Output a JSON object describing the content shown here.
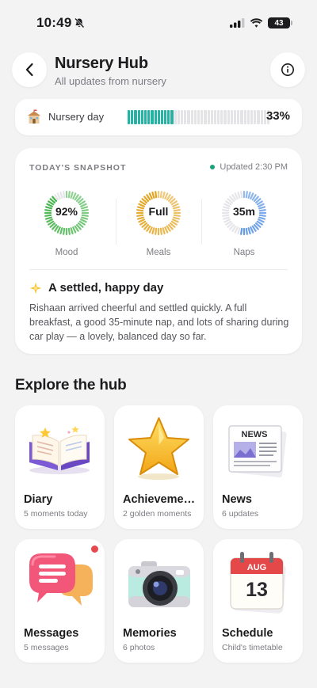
{
  "status_bar": {
    "time": "10:49",
    "battery": "43"
  },
  "header": {
    "title": "Nursery Hub",
    "subtitle": "All updates from nursery"
  },
  "progress": {
    "label": "Nursery day",
    "percent_text": "33%",
    "fraction": 0.33
  },
  "snapshot": {
    "title": "TODAY'S SNAPSHOT",
    "updated": "Updated 2:30 PM",
    "metrics": [
      {
        "value": "92%",
        "label": "Mood",
        "fill": 0.92,
        "color": "#3cb043"
      },
      {
        "value": "Full",
        "label": "Meals",
        "fill": 1.0,
        "color": "#e3a21a"
      },
      {
        "value": "35m",
        "label": "Naps",
        "fill": 0.55,
        "color": "#3b7fe0"
      }
    ],
    "headline": "A settled, happy day",
    "body": "Rishaan arrived cheerful and settled quickly. A full breakfast, a good 35-minute nap, and lots of sharing during car play — a lovely, balanced day so far."
  },
  "explore": {
    "title": "Explore the hub",
    "tiles": [
      {
        "name": "Diary",
        "sub": "5 moments today",
        "icon": "open-book-icon"
      },
      {
        "name": "Achievements",
        "sub": "2 golden moments",
        "icon": "gold-star-icon"
      },
      {
        "name": "News",
        "sub": "6 updates",
        "icon": "newspaper-icon",
        "art_text": "NEWS"
      },
      {
        "name": "Messages",
        "sub": "5 messages",
        "icon": "chat-bubbles-icon",
        "has_badge": true
      },
      {
        "name": "Memories",
        "sub": "6 photos",
        "icon": "camera-icon"
      },
      {
        "name": "Schedule",
        "sub": "Child's timetable",
        "icon": "calendar-icon",
        "art_text_month": "AUG",
        "art_text_day": "13"
      }
    ]
  }
}
